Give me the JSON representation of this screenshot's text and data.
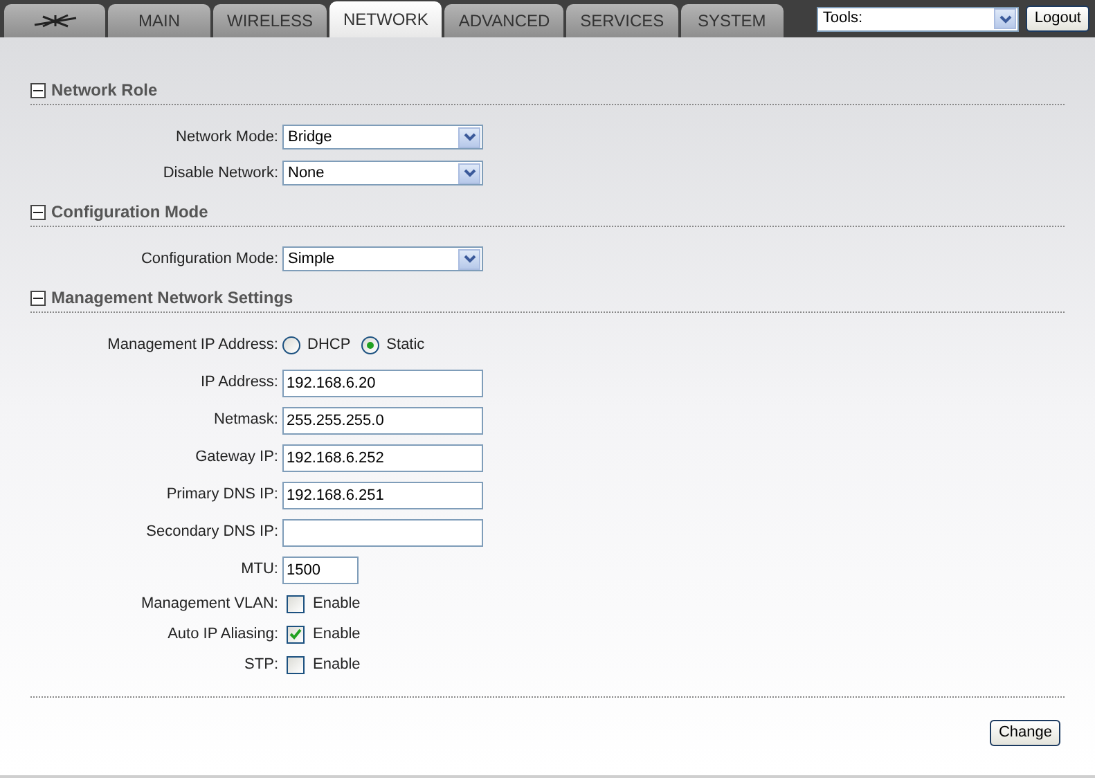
{
  "tabs": [
    {
      "kind": "logo",
      "selected": false
    },
    {
      "label": "MAIN",
      "selected": false
    },
    {
      "label": "WIRELESS",
      "selected": false
    },
    {
      "label": "NETWORK",
      "selected": true
    },
    {
      "label": "ADVANCED",
      "selected": false
    },
    {
      "label": "SERVICES",
      "selected": false
    },
    {
      "label": "SYSTEM",
      "selected": false
    }
  ],
  "tools": {
    "value": "Tools:"
  },
  "logout": "Logout",
  "sections": [
    {
      "title": "Network Role",
      "expanded": true,
      "rows": [
        {
          "kind": "select",
          "label": "Network Mode:",
          "value": "Bridge"
        },
        {
          "kind": "select",
          "label": "Disable Network:",
          "value": "None"
        }
      ]
    },
    {
      "title": "Configuration Mode",
      "expanded": true,
      "rows": [
        {
          "kind": "select",
          "label": "Configuration Mode:",
          "value": "Simple"
        }
      ]
    },
    {
      "title": "Management Network Settings",
      "expanded": true,
      "rows": [
        {
          "kind": "radio",
          "label": "Management IP Address:",
          "options": [
            {
              "label": "DHCP",
              "selected": false
            },
            {
              "label": "Static",
              "selected": true
            }
          ]
        },
        {
          "kind": "text",
          "label": "IP Address:",
          "value": "192.168.6.20"
        },
        {
          "kind": "text",
          "label": "Netmask:",
          "value": "255.255.255.0"
        },
        {
          "kind": "text",
          "label": "Gateway IP:",
          "value": "192.168.6.252"
        },
        {
          "kind": "text",
          "label": "Primary DNS IP:",
          "value": "192.168.6.251"
        },
        {
          "kind": "text",
          "label": "Secondary DNS IP:",
          "value": ""
        },
        {
          "kind": "short",
          "label": "MTU:",
          "value": "1500"
        },
        {
          "kind": "checkbox",
          "label": "Management VLAN:",
          "option": "Enable",
          "checked": false
        },
        {
          "kind": "checkbox",
          "label": "Auto IP Aliasing:",
          "option": "Enable",
          "checked": true
        },
        {
          "kind": "checkbox",
          "label": "STP:",
          "option": "Enable",
          "checked": false
        }
      ]
    }
  ],
  "change": "Change"
}
